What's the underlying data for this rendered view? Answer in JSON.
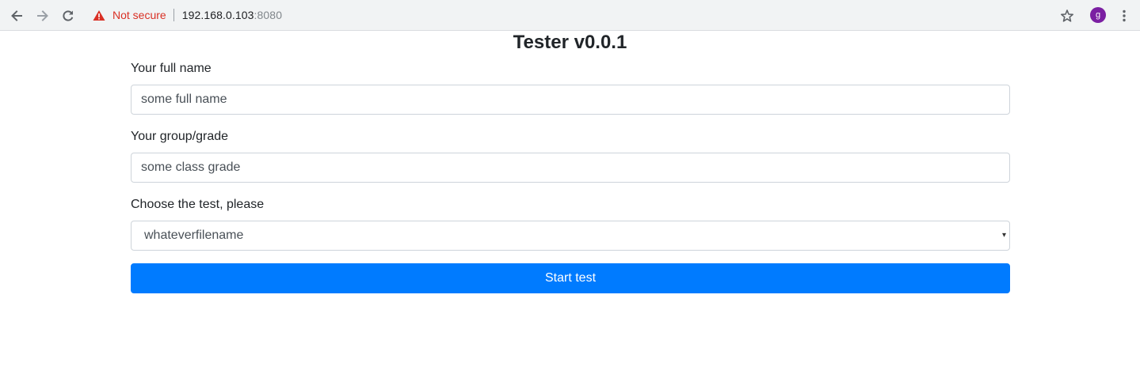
{
  "browser": {
    "security_label": "Not secure",
    "url_host": "192.168.0.103",
    "url_port": ":8080",
    "avatar_letter": "g",
    "icons": {
      "back": "back-arrow-icon",
      "forward": "forward-arrow-icon",
      "reload": "reload-icon",
      "warning": "warning-triangle-icon",
      "bookmark": "star-icon",
      "menu": "kebab-menu-icon"
    },
    "colors": {
      "warning": "#d93025",
      "avatar": "#7b1fa2"
    }
  },
  "page": {
    "title": "Tester v0.0.1",
    "name_field": {
      "label": "Your full name",
      "value": "some full name"
    },
    "group_field": {
      "label": "Your group/grade",
      "value": "some class grade"
    },
    "test_select": {
      "label": "Choose the test, please",
      "selected": "whateverfilename",
      "caret": "▾"
    },
    "start_button": {
      "label": "Start test",
      "color": "#007bff"
    }
  }
}
